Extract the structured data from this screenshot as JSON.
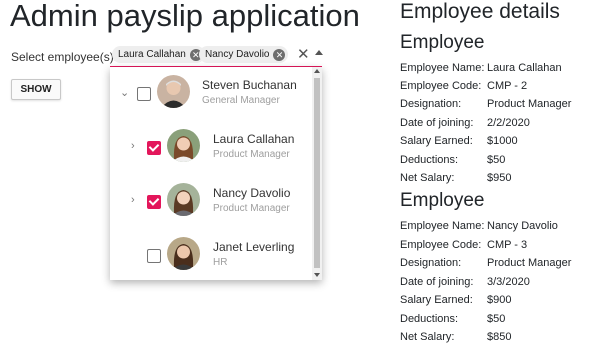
{
  "page": {
    "title": "Admin payslip application"
  },
  "selector": {
    "label": "Select employee(s):",
    "chips": [
      {
        "label": "Laura Callahan"
      },
      {
        "label": "Nancy Davolio"
      }
    ],
    "clear_icon": "close-icon",
    "toggle_icon": "caret-up-icon"
  },
  "show_button": {
    "label": "SHOW"
  },
  "tree": {
    "items": [
      {
        "name": "Steven Buchanan",
        "role": "General Manager",
        "checked": false,
        "expander": "chevron-down"
      },
      {
        "name": "Laura Callahan",
        "role": "Product Manager",
        "checked": true,
        "expander": "chevron-right"
      },
      {
        "name": "Nancy Davolio",
        "role": "Product Manager",
        "checked": true,
        "expander": "chevron-right"
      },
      {
        "name": "Janet Leverling",
        "role": "HR",
        "checked": false,
        "expander": ""
      }
    ]
  },
  "details": {
    "title": "Employee details",
    "employees": [
      {
        "heading": "Employee",
        "fields": [
          {
            "label": "Employee Name:",
            "value": "Laura Callahan"
          },
          {
            "label": "Employee Code:",
            "value": "CMP - 2"
          },
          {
            "label": "Designation:",
            "value": "Product Manager"
          },
          {
            "label": "Date of joining:",
            "value": "2/2/2020"
          },
          {
            "label": "Salary Earned:",
            "value": "$1000"
          },
          {
            "label": "Deductions:",
            "value": "$50"
          },
          {
            "label": "Net Salary:",
            "value": "$950"
          }
        ]
      },
      {
        "heading": "Employee",
        "fields": [
          {
            "label": "Employee Name:",
            "value": "Nancy Davolio"
          },
          {
            "label": "Employee Code:",
            "value": "CMP - 3"
          },
          {
            "label": "Designation:",
            "value": "Product Manager"
          },
          {
            "label": "Date of joining:",
            "value": "3/3/2020"
          },
          {
            "label": "Salary Earned:",
            "value": "$900"
          },
          {
            "label": "Deductions:",
            "value": "$50"
          },
          {
            "label": "Net Salary:",
            "value": "$850"
          }
        ]
      }
    ]
  },
  "colors": {
    "accent": "#e3165b"
  }
}
